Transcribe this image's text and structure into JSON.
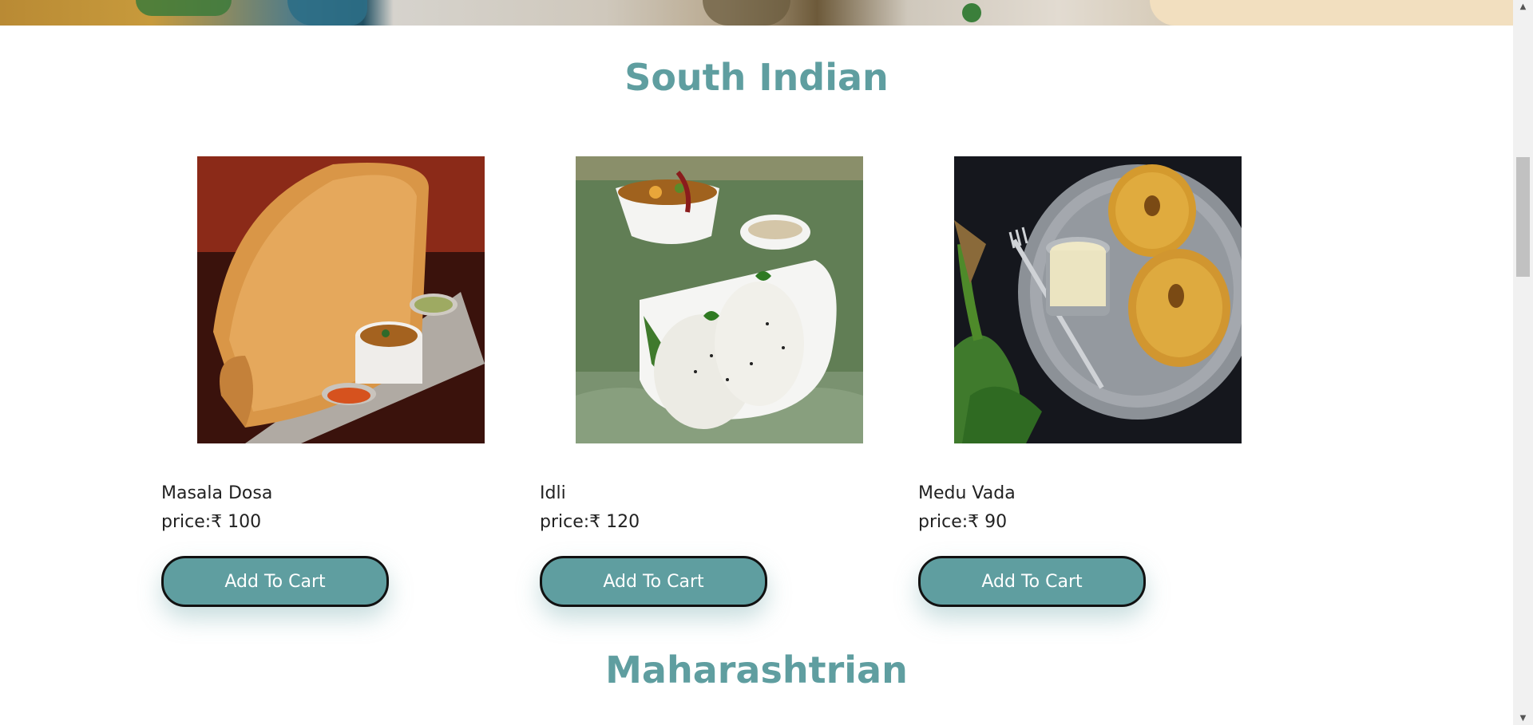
{
  "sections": {
    "south_indian_title": "South Indian",
    "maharashtrian_title": "Maharashtrian"
  },
  "items": [
    {
      "name": "Masala Dosa",
      "price": "price:₹ 100",
      "button": "Add To Cart"
    },
    {
      "name": "Idli",
      "price": "price:₹ 120",
      "button": "Add To Cart"
    },
    {
      "name": "Medu Vada",
      "price": "price:₹ 90",
      "button": "Add To Cart"
    }
  ],
  "colors": {
    "accent": "#5f9ea0",
    "text": "#222222",
    "background": "#ffffff"
  },
  "scrollbar": {
    "up_icon": "chevron-up-icon",
    "down_icon": "chevron-down-icon"
  }
}
